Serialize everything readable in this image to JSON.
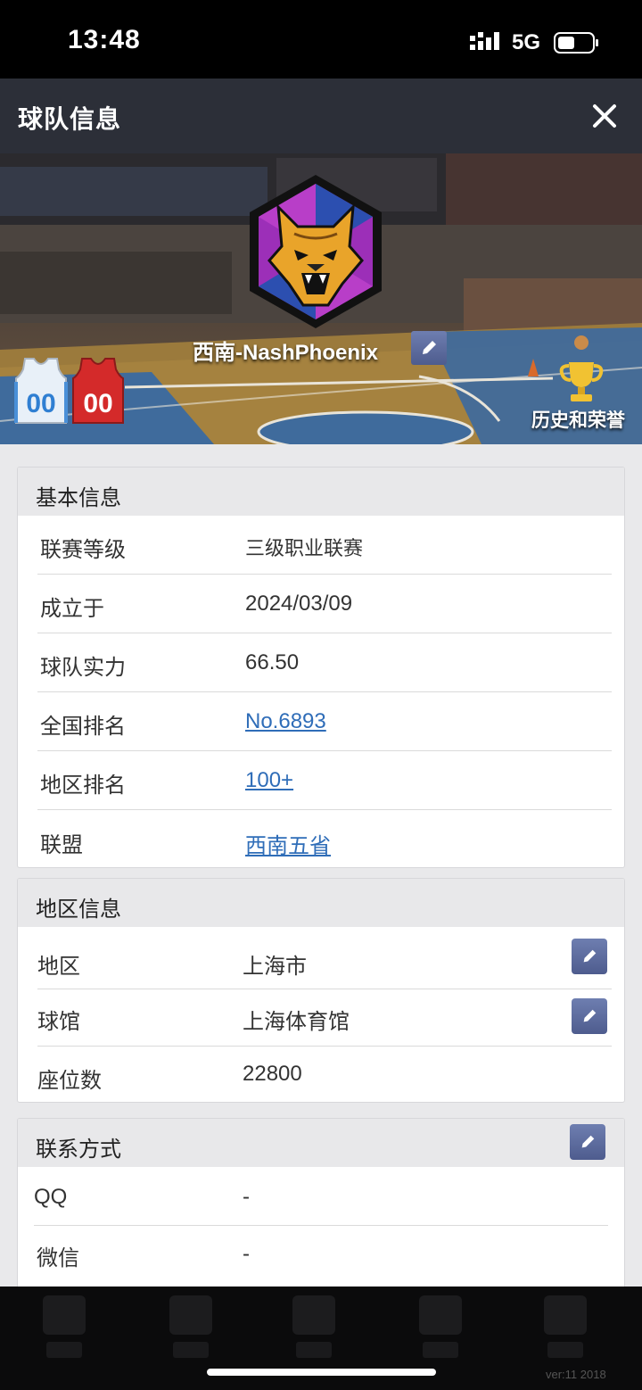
{
  "status_bar": {
    "time": "13:48",
    "network": "5G"
  },
  "header": {
    "title": "球队信息"
  },
  "banner": {
    "team_name": "西南-NashPhoenix",
    "home_jersey_number": "00",
    "away_jersey_number": "00",
    "history_label": "历史和荣誉"
  },
  "basic_info": {
    "title": "基本信息",
    "rows": [
      {
        "label": "联赛等级",
        "value": "三级职业联赛"
      },
      {
        "label": "成立于",
        "value": "2024/03/09"
      },
      {
        "label": "球队实力",
        "value": "66.50"
      },
      {
        "label": "全国排名",
        "value": "No.6893"
      },
      {
        "label": "地区排名",
        "value": "100+"
      },
      {
        "label": "联盟",
        "value": "西南五省"
      }
    ]
  },
  "region_info": {
    "title": "地区信息",
    "rows": [
      {
        "label": "地区",
        "value": "上海市"
      },
      {
        "label": "球馆",
        "value": "上海体育馆"
      },
      {
        "label": "座位数",
        "value": "22800"
      }
    ]
  },
  "contact": {
    "title": "联系方式",
    "rows": [
      {
        "label": "QQ",
        "value": "-"
      },
      {
        "label": "微信",
        "value": "-"
      }
    ]
  },
  "footer": {
    "version": "ver:11  2018"
  },
  "colors": {
    "header_bg": "#2c2f38",
    "edit_button": "#5a6a9e",
    "link": "#2f6db8",
    "logo_purple": "#9c2fb8",
    "logo_blue": "#2c4fb0",
    "home_jersey": "#e8f0f8",
    "away_jersey": "#d42a2a"
  }
}
